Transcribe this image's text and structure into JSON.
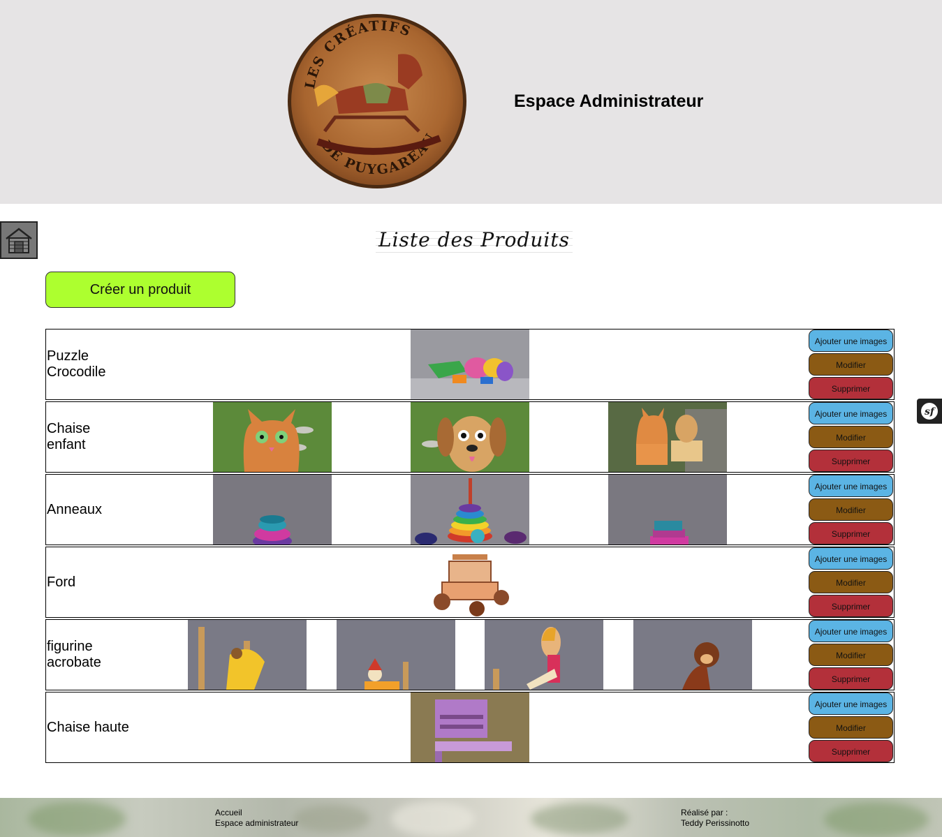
{
  "header": {
    "logo_top_text": "LES CRÉATIFS",
    "logo_bottom_text": "DE PUYGAREAU",
    "admin_title": "Espace Administrateur"
  },
  "page": {
    "list_title": "Liste des Produits",
    "create_button": "Créer un produit",
    "home_icon": "house-icon"
  },
  "actions": {
    "add_images": "Ajouter une images",
    "edit": "Modifier",
    "delete": "Supprimer"
  },
  "products": [
    {
      "name": "Puzzle\nCrocodile",
      "images": [
        "crocodile-puzzle"
      ]
    },
    {
      "name": "Chaise\nenfant",
      "images": [
        "cat-chair",
        "dog-chair",
        "cat-and-dog-chairs"
      ]
    },
    {
      "name": "Anneaux",
      "images": [
        "rings-top",
        "rings-stacker",
        "rings-detail"
      ]
    },
    {
      "name": "Ford",
      "images": [
        "wooden-car"
      ]
    },
    {
      "name": "figurine\nacrobate",
      "images": [
        "acrobat-bear",
        "acrobat-clown",
        "acrobat-woman",
        "acrobat-monkey"
      ]
    },
    {
      "name": "Chaise haute",
      "images": [
        "high-chair"
      ]
    }
  ],
  "footer": {
    "link_home": "Accueil",
    "link_admin": "Espace administrateur",
    "credit_label": "Réalisé par :",
    "credit_name": "Teddy Perissinotto"
  },
  "colors": {
    "header_bg": "#e6e4e5",
    "create_button": "#adff2f",
    "add_images_button": "#5bb4e4",
    "edit_button": "#8b5a14",
    "delete_button": "#b3303a"
  }
}
